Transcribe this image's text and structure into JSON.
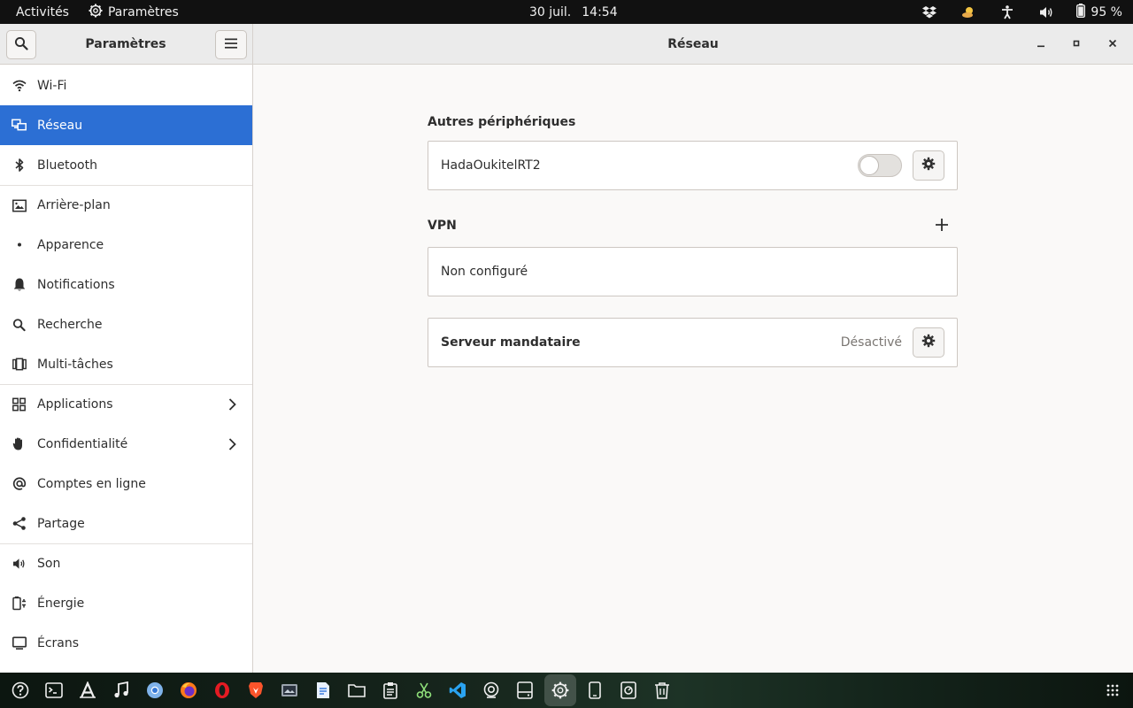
{
  "topbar": {
    "activities": "Activités",
    "app_name": "Paramètres",
    "date": "30 juil.",
    "time": "14:54",
    "battery": "95 %"
  },
  "headerbar": {
    "sidebar_title": "Paramètres",
    "page_title": "Réseau"
  },
  "sidebar": {
    "items": [
      {
        "label": "Wi-Fi",
        "icon": "wifi-icon"
      },
      {
        "label": "Réseau",
        "icon": "network-icon"
      },
      {
        "label": "Bluetooth",
        "icon": "bluetooth-icon"
      },
      {
        "label": "Arrière-plan",
        "icon": "background-icon"
      },
      {
        "label": "Apparence",
        "icon": "appearance-icon"
      },
      {
        "label": "Notifications",
        "icon": "bell-icon"
      },
      {
        "label": "Recherche",
        "icon": "search-icon"
      },
      {
        "label": "Multi-tâches",
        "icon": "multitask-icon"
      },
      {
        "label": "Applications",
        "icon": "apps-icon"
      },
      {
        "label": "Confidentialité",
        "icon": "hand-icon"
      },
      {
        "label": "Comptes en ligne",
        "icon": "at-icon"
      },
      {
        "label": "Partage",
        "icon": "share-icon"
      },
      {
        "label": "Son",
        "icon": "speaker-icon"
      },
      {
        "label": "Énergie",
        "icon": "power-icon"
      },
      {
        "label": "Écrans",
        "icon": "display-icon"
      }
    ]
  },
  "content": {
    "other_devices_title": "Autres périphériques",
    "device_name": "HadaOukitelRT2",
    "device_enabled": false,
    "vpn_title": "VPN",
    "vpn_status": "Non configuré",
    "proxy_label": "Serveur mandataire",
    "proxy_status": "Désactivé"
  },
  "colors": {
    "accent": "#2c6fd4",
    "topbar": "#111111",
    "window_bg": "#faf9f8"
  }
}
